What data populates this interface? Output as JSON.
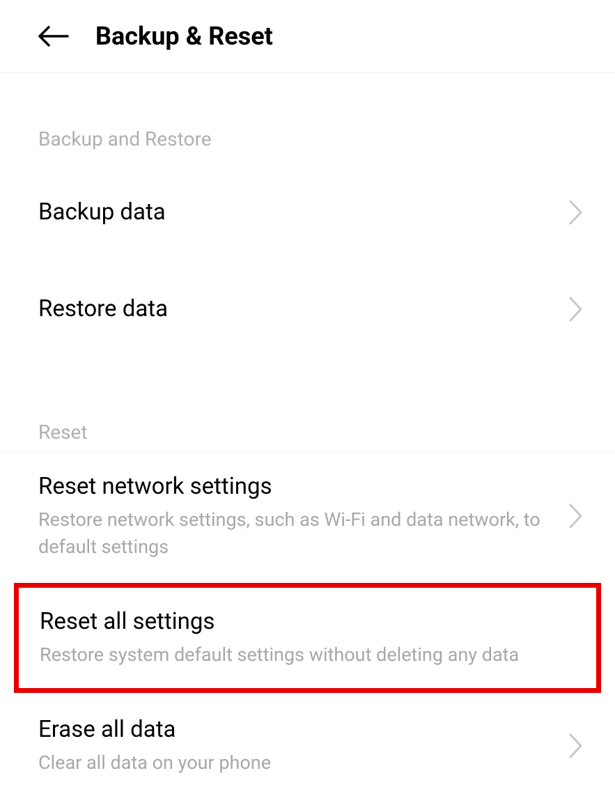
{
  "header": {
    "title": "Backup & Reset"
  },
  "sections": {
    "backup_restore": {
      "label": "Backup and Restore",
      "items": [
        {
          "title": "Backup data"
        },
        {
          "title": "Restore data"
        }
      ]
    },
    "reset": {
      "label": "Reset",
      "items": [
        {
          "title": "Reset network settings",
          "subtitle": "Restore network settings, such as Wi-Fi and data network, to default settings"
        },
        {
          "title": "Reset all settings",
          "subtitle": "Restore system default settings without deleting any data"
        },
        {
          "title": "Erase all data",
          "subtitle": "Clear all data on your phone"
        }
      ]
    }
  }
}
